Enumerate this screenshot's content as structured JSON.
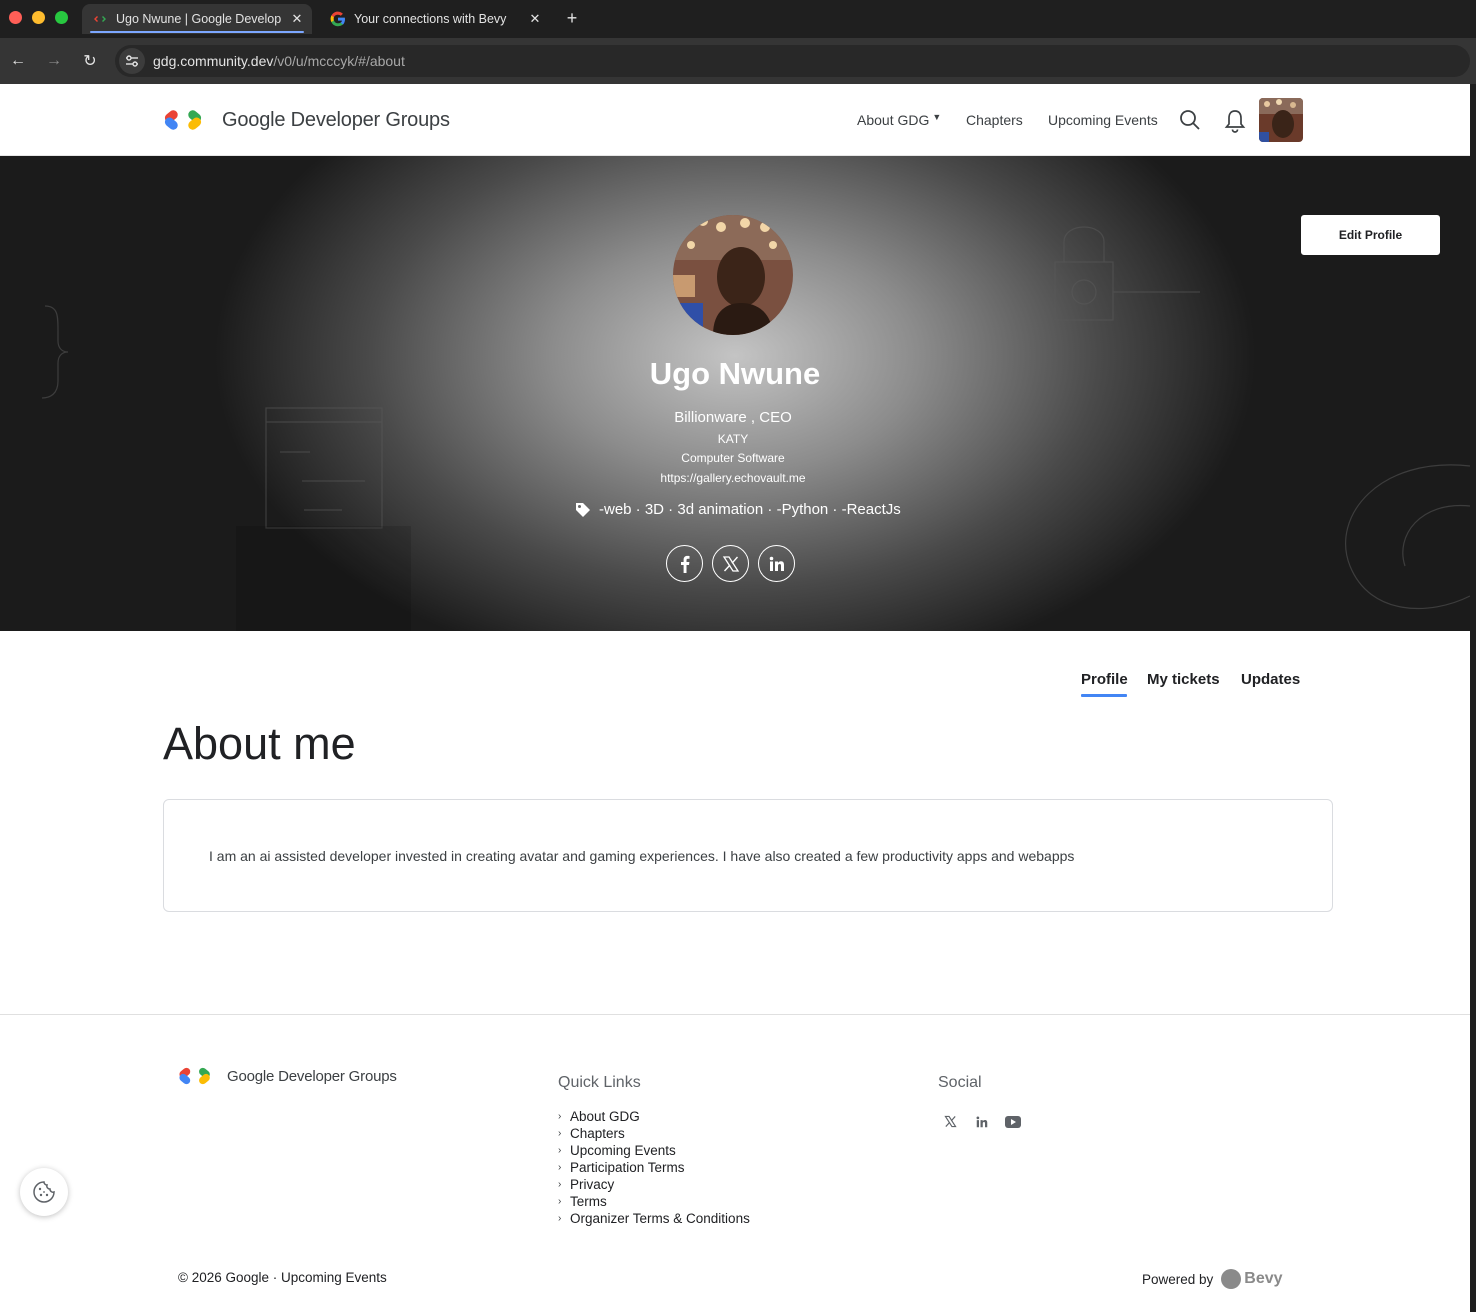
{
  "browser": {
    "tabs": [
      {
        "title": "Ugo Nwune | Google Develop",
        "active": true
      },
      {
        "title": "Your connections with Bevy",
        "active": false
      }
    ],
    "new_tab_label": "+",
    "url_host": "gdg.community.dev",
    "url_path": "/v0/u/mcccyk/#/about"
  },
  "header": {
    "brand": "Google Developer Groups",
    "nav": {
      "about": "About GDG",
      "chapters": "Chapters",
      "events": "Upcoming Events"
    }
  },
  "profile": {
    "edit_label": "Edit Profile",
    "name": "Ugo Nwune",
    "role": "Billionware , CEO",
    "location": "KATY",
    "industry": "Computer Software",
    "website": "https://gallery.echovault.me",
    "tags": "-web · 3D · 3d animation · -Python · -ReactJs",
    "social": [
      "facebook",
      "x",
      "linkedin"
    ]
  },
  "tabs": {
    "profile": "Profile",
    "tickets": "My tickets",
    "updates": "Updates"
  },
  "about": {
    "title": "About me",
    "body": "I am an ai assisted developer invested in creating avatar and gaming experiences. I have also created a few productivity apps and webapps"
  },
  "footer": {
    "brand": "Google Developer Groups",
    "quick_links_heading": "Quick Links",
    "quick_links": [
      "About GDG",
      "Chapters",
      "Upcoming Events",
      "Participation Terms",
      "Privacy",
      "Terms",
      "Organizer Terms & Conditions"
    ],
    "social_heading": "Social",
    "social_icons": [
      "x-icon",
      "linkedin-icon",
      "youtube-icon"
    ],
    "copyright": "© 2026 Google ·  Upcoming Events",
    "powered_by": "Powered by",
    "bevy": "Bevy"
  },
  "colors": {
    "accent": "#4285f4",
    "tab_underline": "#7ca7ff"
  }
}
